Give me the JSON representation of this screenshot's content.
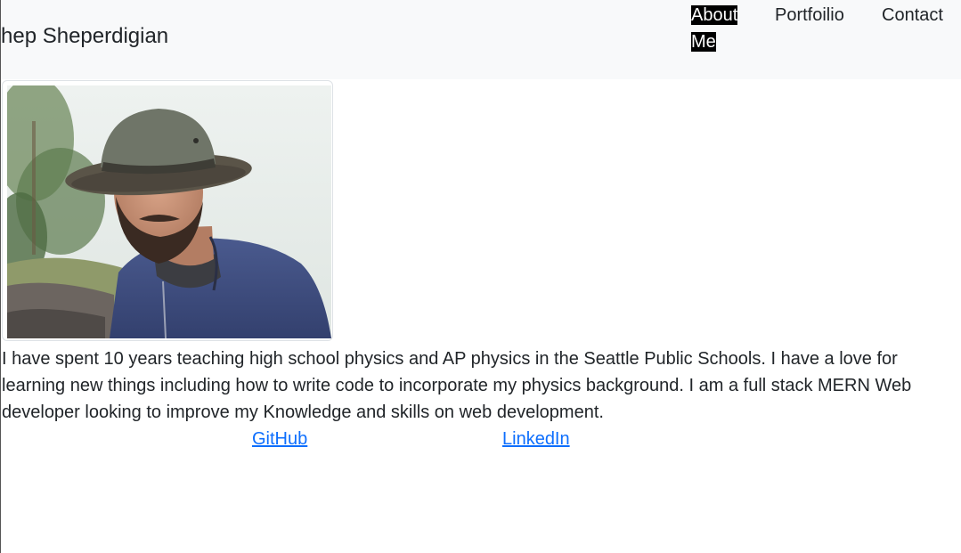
{
  "navbar": {
    "brand": "hep Sheperdigian",
    "links": [
      {
        "label_line1": "About",
        "label_line2": "Me",
        "active": true
      },
      {
        "label": "Portfoilio"
      },
      {
        "label": "Contact"
      }
    ]
  },
  "profile": {
    "photo_alt": "man in bucket hat",
    "bio": "I have spent 10 years teaching high school physics and AP physics in the Seattle Public Schools. I have a love for learning new things including how to write code to incorporate my physics background. I am a full stack MERN Web developer looking to improve my Knowledge and skills on web development."
  },
  "social": {
    "github": "GitHub",
    "linkedin": "LinkedIn"
  },
  "colors": {
    "navbar_bg": "#f8f9fa",
    "active_link_bg": "#000000",
    "link_blue": "#0d6efd",
    "text": "#212529"
  }
}
